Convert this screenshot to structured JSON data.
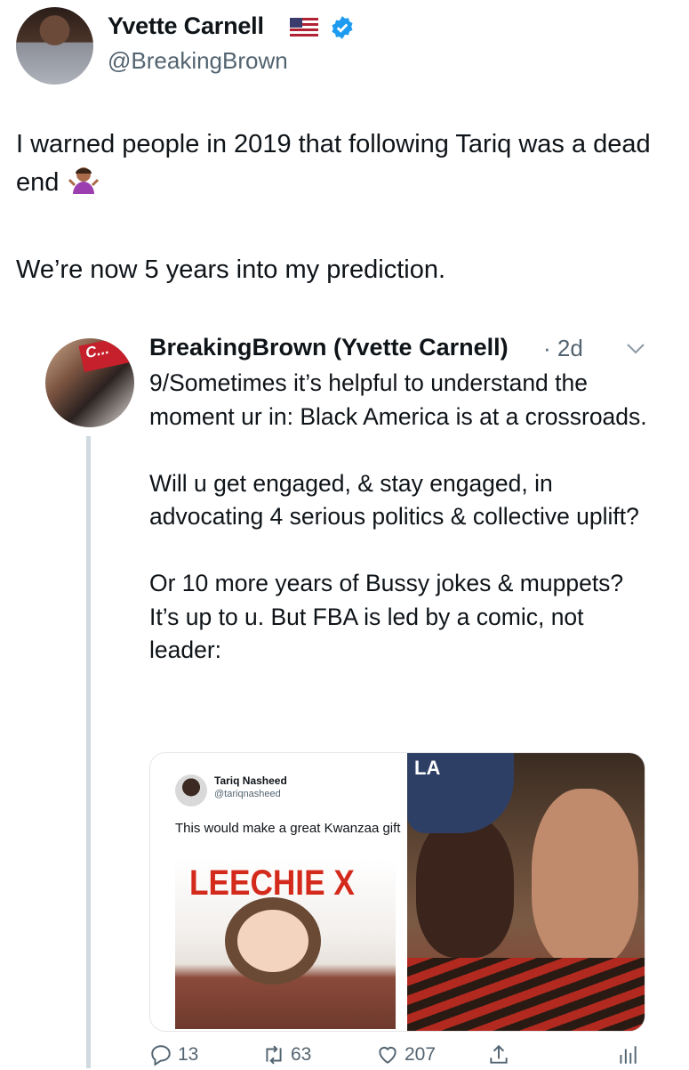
{
  "author": {
    "display_name": "Yvette Carnell",
    "handle": "@BreakingBrown",
    "flag_icon": "us-flag-icon",
    "verified_icon": "verified-badge-icon",
    "verified_color": "#1d9bf0"
  },
  "tweet": {
    "line1": "I warned people in 2019 that following Tariq was a dead end",
    "emoji": "person-shrugging-emoji",
    "line2": "We’re now 5 years into my prediction."
  },
  "quoted": {
    "author_label": "BreakingBrown (Yvette Carnell)",
    "separator": "·",
    "time": "2d",
    "avatar_text": "C...",
    "paragraphs": [
      "9/Sometimes it’s helpful to understand the moment ur in: Black America is at a crossroads.",
      "Will u get engaged, & stay engaged, in advocating 4 serious politics & collective uplift?",
      "Or 10 more years of Bussy jokes & muppets? It’s up to u. But FBA is led by a comic, not leader:"
    ],
    "media": {
      "inner_name": "Tariq Nasheed",
      "inner_handle": "@tariqnasheed",
      "inner_text": "This would make a great Kwanzaa gift",
      "poster_text": "LEECHIE X",
      "cap_text": "LA"
    },
    "actions": {
      "replies": "13",
      "retweets": "63",
      "likes": "207"
    }
  },
  "colors": {
    "text": "#0f1419",
    "secondary": "#536471",
    "thread_line": "#cfd9de",
    "poster_red": "#d42a1c"
  }
}
